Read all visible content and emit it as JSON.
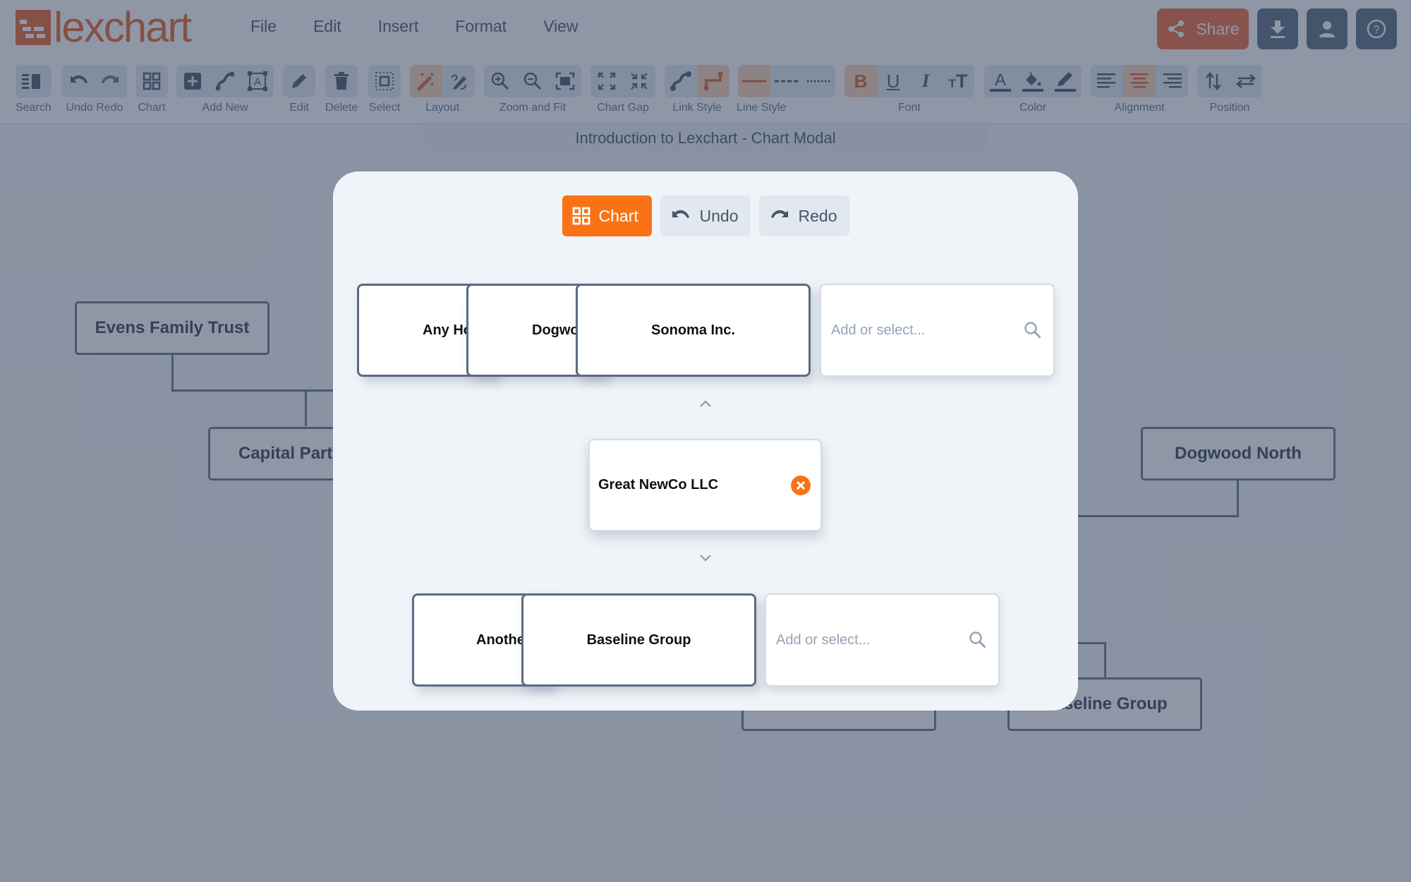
{
  "app": {
    "brand": "lexchart",
    "menu": [
      "File",
      "Edit",
      "Insert",
      "Format",
      "View"
    ],
    "share_label": "Share",
    "header_icons": [
      "download-icon",
      "user-icon",
      "help-icon"
    ],
    "accent_color": "#f97316"
  },
  "toolbar": {
    "groups": [
      {
        "label": "Search",
        "buttons": [
          "search-panel-icon"
        ]
      },
      {
        "label": "Undo Redo",
        "buttons": [
          "undo-icon",
          "redo-icon"
        ]
      },
      {
        "label": "Chart",
        "buttons": [
          "grid-icon"
        ]
      },
      {
        "label": "Add New",
        "buttons": [
          "add-box-icon",
          "add-link-icon",
          "add-text-icon"
        ]
      },
      {
        "label": "Edit",
        "buttons": [
          "pencil-icon"
        ]
      },
      {
        "label": "Delete",
        "buttons": [
          "trash-icon"
        ]
      },
      {
        "label": "Select",
        "buttons": [
          "select-icon"
        ]
      },
      {
        "label": "Layout",
        "buttons": [
          "magic-wand-icon",
          "manual-layout-icon"
        ],
        "active": 0
      },
      {
        "label": "Zoom and Fit",
        "buttons": [
          "zoom-in-icon",
          "zoom-out-icon",
          "fit-screen-icon"
        ]
      },
      {
        "label": "Chart Gap",
        "buttons": [
          "expand-icon",
          "compress-icon"
        ]
      },
      {
        "label": "Link Style",
        "buttons": [
          "curved-link-icon",
          "elbow-link-icon"
        ],
        "active": 1
      },
      {
        "label": "Line Style",
        "buttons": [
          "solid-line-icon",
          "dashed-line-icon",
          "dotted-line-icon"
        ],
        "active": 0
      },
      {
        "label": "Font",
        "buttons": [
          "bold-icon",
          "underline-icon",
          "italic-icon",
          "text-size-icon"
        ],
        "active": 0
      },
      {
        "label": "Color",
        "buttons": [
          "text-color-icon",
          "fill-color-icon",
          "line-color-icon"
        ]
      },
      {
        "label": "Alignment",
        "buttons": [
          "align-left-icon",
          "align-center-icon",
          "align-right-icon"
        ],
        "active": 1
      },
      {
        "label": "Position",
        "buttons": [
          "swap-vertical-icon",
          "swap-horizontal-icon"
        ]
      }
    ]
  },
  "canvas": {
    "document_title": "Introduction to Lexchart - Chart Modal",
    "nodes": [
      "Evens Family Trust",
      "Capital Partners",
      "Dogwood North",
      "Baseline Group"
    ]
  },
  "modal": {
    "chart_label": "Chart",
    "undo_label": "Undo",
    "redo_label": "Redo",
    "parents": {
      "cards": [
        "Any Holdings",
        "Dogwood",
        "Sonoma Inc."
      ],
      "visible_text": [
        "Any Ho",
        "Dogwo",
        "Sonoma Inc."
      ],
      "input_placeholder": "Add or select..."
    },
    "focus_entity": "Great NewCo LLC",
    "children": {
      "cards": [
        "Another",
        "Baseline Group"
      ],
      "visible_text": [
        "Anothe",
        "Baseline Group"
      ],
      "input_placeholder": "Add or select..."
    }
  }
}
